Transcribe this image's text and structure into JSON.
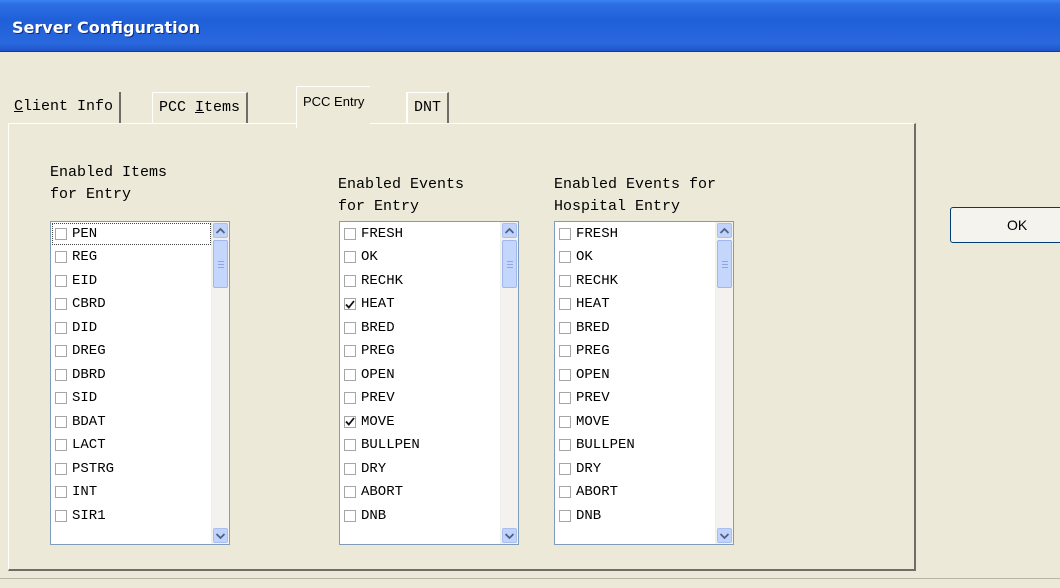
{
  "window": {
    "title": "Server Configuration"
  },
  "tabs": [
    {
      "label": "Client Info",
      "mnemonic": "C",
      "rest": "lient Info"
    },
    {
      "label": "PCC Items",
      "prefix": "PCC ",
      "mnemonic": "I",
      "rest": "tems"
    },
    {
      "label": "PCC Entry"
    },
    {
      "label": "DNT"
    }
  ],
  "lists": [
    {
      "label_line1": "Enabled Items",
      "label_line2": "for Entry",
      "items": [
        {
          "text": "PEN",
          "checked": false
        },
        {
          "text": "REG",
          "checked": false
        },
        {
          "text": "EID",
          "checked": false
        },
        {
          "text": "CBRD",
          "checked": false
        },
        {
          "text": "DID",
          "checked": false
        },
        {
          "text": "DREG",
          "checked": false
        },
        {
          "text": "DBRD",
          "checked": false
        },
        {
          "text": "SID",
          "checked": false
        },
        {
          "text": "BDAT",
          "checked": false
        },
        {
          "text": "LACT",
          "checked": false
        },
        {
          "text": "PSTRG",
          "checked": false
        },
        {
          "text": "INT",
          "checked": false
        },
        {
          "text": "SIR1",
          "checked": false
        }
      ]
    },
    {
      "label_line1": "Enabled Events",
      "label_line2": "for Entry",
      "items": [
        {
          "text": "FRESH",
          "checked": false
        },
        {
          "text": "OK",
          "checked": false
        },
        {
          "text": "RECHK",
          "checked": false
        },
        {
          "text": "HEAT",
          "checked": true
        },
        {
          "text": "BRED",
          "checked": false
        },
        {
          "text": "PREG",
          "checked": false
        },
        {
          "text": "OPEN",
          "checked": false
        },
        {
          "text": "PREV",
          "checked": false
        },
        {
          "text": "MOVE",
          "checked": true
        },
        {
          "text": "BULLPEN",
          "checked": false
        },
        {
          "text": "DRY",
          "checked": false
        },
        {
          "text": "ABORT",
          "checked": false
        },
        {
          "text": "DNB",
          "checked": false
        }
      ]
    },
    {
      "label_line1": "Enabled Events for",
      "label_line2": "Hospital Entry",
      "items": [
        {
          "text": "FRESH",
          "checked": false
        },
        {
          "text": "OK",
          "checked": false
        },
        {
          "text": "RECHK",
          "checked": false
        },
        {
          "text": "HEAT",
          "checked": false
        },
        {
          "text": "BRED",
          "checked": false
        },
        {
          "text": "PREG",
          "checked": false
        },
        {
          "text": "OPEN",
          "checked": false
        },
        {
          "text": "PREV",
          "checked": false
        },
        {
          "text": "MOVE",
          "checked": false
        },
        {
          "text": "BULLPEN",
          "checked": false
        },
        {
          "text": "DRY",
          "checked": false
        },
        {
          "text": "ABORT",
          "checked": false
        },
        {
          "text": "DNB",
          "checked": false
        }
      ]
    }
  ],
  "ok_button": {
    "label": "OK"
  },
  "icons": {
    "scroll_up": "arrow-up-icon",
    "scroll_down": "arrow-down-icon",
    "check": "checkmark-icon"
  },
  "colors": {
    "titlebar": "#2a68de",
    "dialog_bg": "#ece9d8",
    "scroll_button": "#c1d3fb"
  }
}
